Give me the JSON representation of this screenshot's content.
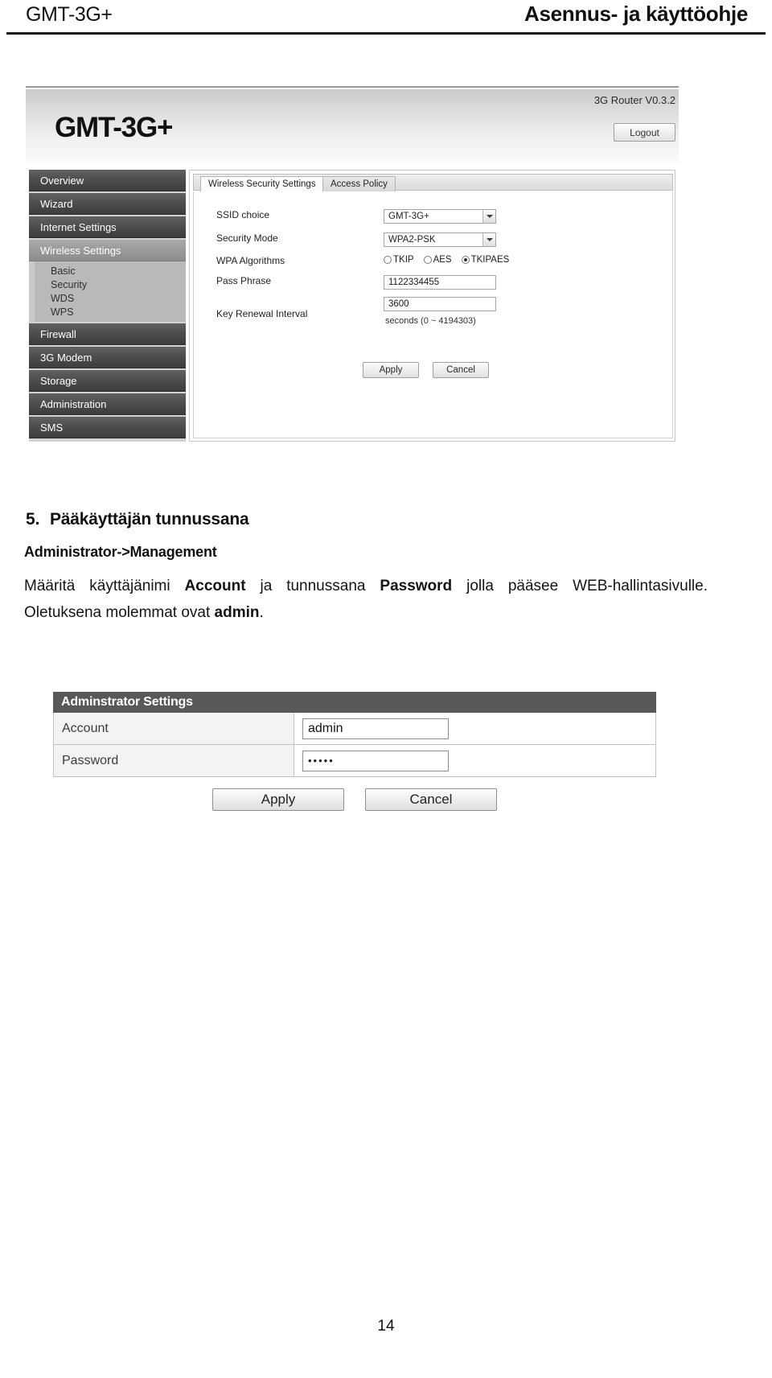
{
  "doc_header": {
    "left": "GMT-3G+",
    "right": "Asennus- ja käyttöohje"
  },
  "screenshot_wireless": {
    "brand_logo": "GMT-3G+",
    "version": "3G Router V0.3.2",
    "logout_label": "Logout",
    "nav": [
      {
        "label": "Overview",
        "active": false
      },
      {
        "label": "Wizard",
        "active": false
      },
      {
        "label": "Internet Settings",
        "active": false
      },
      {
        "label": "Wireless Settings",
        "active": true
      }
    ],
    "nav_sub": [
      "Basic",
      "Security",
      "WDS",
      "WPS"
    ],
    "nav_rest": [
      {
        "label": "Firewall"
      },
      {
        "label": "3G Modem"
      },
      {
        "label": "Storage"
      },
      {
        "label": "Administration"
      },
      {
        "label": "SMS"
      }
    ],
    "tabs": [
      {
        "label": "Wireless Security Settings",
        "selected": true
      },
      {
        "label": "Access Policy",
        "selected": false
      }
    ],
    "fields": {
      "ssid_label": "SSID choice",
      "ssid_value": "GMT-3G+",
      "security_label": "Security Mode",
      "security_value": "WPA2-PSK",
      "algorithms_label": "WPA Algorithms",
      "algorithms": [
        {
          "label": "TKIP",
          "selected": false
        },
        {
          "label": "AES",
          "selected": false
        },
        {
          "label": "TKIPAES",
          "selected": true
        }
      ],
      "passphrase_label": "Pass Phrase",
      "passphrase_value": "1122334455",
      "renewal_label": "Key Renewal Interval",
      "renewal_value": "3600",
      "renewal_hint": "seconds   (0 ~ 4194303)"
    },
    "buttons": {
      "apply": "Apply",
      "cancel": "Cancel"
    }
  },
  "section": {
    "number": "5.",
    "title": "Pääkäyttäjän tunnussana",
    "subtitle": "Administrator->Management",
    "paragraph_parts": [
      {
        "text": "Määritä  käyttäjänimi  ",
        "bold": false
      },
      {
        "text": "Account",
        "bold": true
      },
      {
        "text": "  ja  tunnussana  ",
        "bold": false
      },
      {
        "text": "Password",
        "bold": true
      },
      {
        "text": "  jolla  pääsee  WEB-hallintasivulle.  Oletuksena  molemmat  ovat  ",
        "bold": false
      },
      {
        "text": "admin",
        "bold": true
      },
      {
        "text": ".",
        "bold": false
      }
    ]
  },
  "screenshot_admin": {
    "panel_title": "Adminstrator Settings",
    "rows": [
      {
        "label": "Account",
        "value": "admin",
        "masked": false
      },
      {
        "label": "Password",
        "value": "•••••",
        "masked": true
      }
    ],
    "buttons": {
      "apply": "Apply",
      "cancel": "Cancel"
    }
  },
  "footer": {
    "page_number": "14"
  }
}
